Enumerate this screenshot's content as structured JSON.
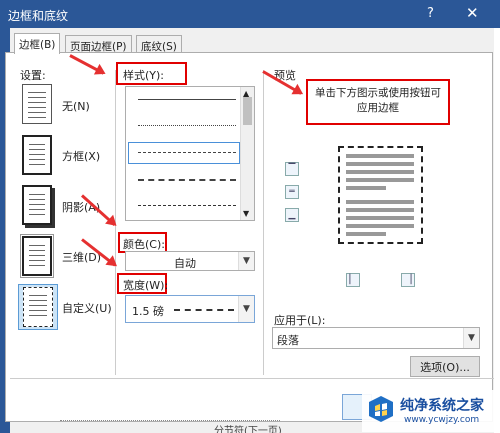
{
  "window": {
    "title": "边框和底纹",
    "help": "?",
    "close": "✕"
  },
  "tabs": [
    {
      "label": "边框(B)"
    },
    {
      "label": "页面边框(P)"
    },
    {
      "label": "底纹(S)"
    }
  ],
  "settings": {
    "heading": "设置:",
    "items": [
      {
        "label": "无(N)"
      },
      {
        "label": "方框(X)"
      },
      {
        "label": "阴影(A)"
      },
      {
        "label": "三维(D)"
      },
      {
        "label": "自定义(U)"
      }
    ]
  },
  "style": {
    "label": "样式(Y):"
  },
  "color": {
    "label": "颜色(C):",
    "value": "自动"
  },
  "width": {
    "label": "宽度(W):",
    "value": "1.5 磅"
  },
  "preview": {
    "heading": "预览",
    "hint": "单击下方图示或使用按钮可应用边框"
  },
  "apply_to": {
    "label": "应用于(L):",
    "value": "段落"
  },
  "options_button": {
    "label": "选项(O)..."
  },
  "background_text": "分节符(下一页)",
  "watermark": {
    "title": "纯净系统之家",
    "url": "www.ycwjzy.com"
  },
  "colors": {
    "title_bar": "#2b5797",
    "annotation_red": "#e00000"
  }
}
